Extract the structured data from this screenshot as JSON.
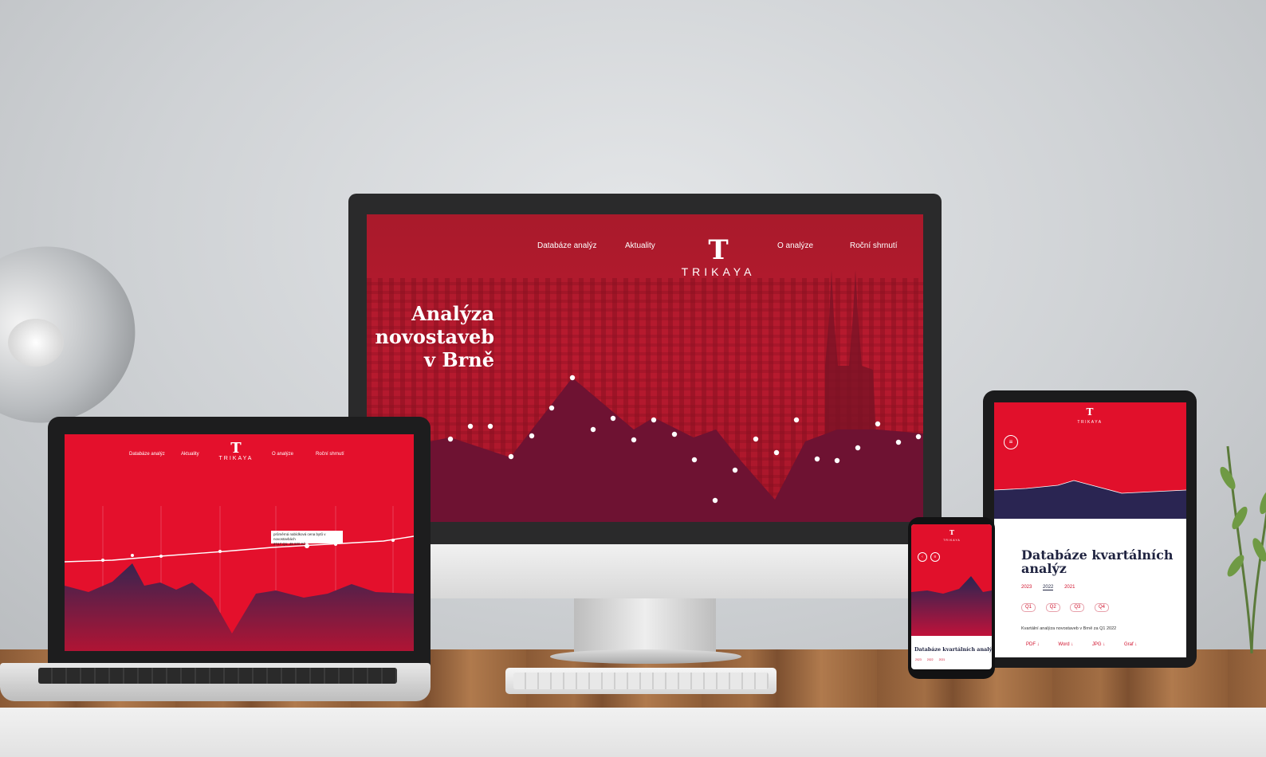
{
  "brand": {
    "logo_mark": "T",
    "logo_word": "TRIKAYA",
    "accent": "#e1102b",
    "dark_accent": "#6e1232",
    "navy": "#1f2340"
  },
  "desktop": {
    "nav": {
      "item1": "Databáze analýz",
      "item2": "Aktuality",
      "item3": "O analýze",
      "item4": "Roční shrnutí"
    },
    "hero": {
      "line1": "Analýza",
      "line2": "novostaveb",
      "line3": "v Brně"
    }
  },
  "laptop": {
    "nav": {
      "item1": "Databáze analýz",
      "item2": "Aktuality",
      "item3": "O analýze",
      "item4": "Roční shrnutí"
    },
    "tooltip_line1": "průměrná nabídková cena bytů v novostavbách",
    "tooltip_line2": "2017 Q1: 49 600 Kč"
  },
  "tablet": {
    "title": "Databáze kvartálních analýz",
    "years": [
      "2023",
      "2022",
      "2021"
    ],
    "active_year": "2022",
    "quarters": [
      "Q1",
      "Q2",
      "Q3",
      "Q4"
    ],
    "description": "Kvartální analýza novostaveb v Brně za Q1 2022",
    "downloads": [
      "PDF ↓",
      "Word ↓",
      "JPG ↓",
      "Graf ↓"
    ],
    "menu_icon": "menu-icon"
  },
  "phone": {
    "title": "Databáze kvartálních analýz",
    "years": [
      "2023",
      "2022",
      "2021"
    ]
  }
}
